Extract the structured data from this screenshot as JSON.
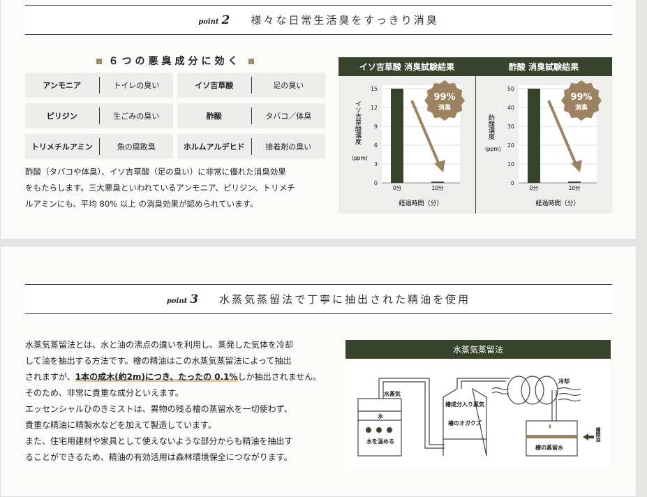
{
  "point2": {
    "label": "point",
    "num": "2",
    "title": "様々な日常生活臭をすっきり消臭"
  },
  "odor": {
    "heading": "６つの悪臭成分に効く",
    "items": [
      {
        "name": "アンモニア",
        "smell": "トイレの臭い"
      },
      {
        "name": "イソ吉草酸",
        "smell": "足の臭い"
      },
      {
        "name": "ピリジン",
        "smell": "生ごみの臭い"
      },
      {
        "name": "酢酸",
        "smell": "タバコ／体臭"
      },
      {
        "name": "トリメチルアミン",
        "smell": "魚の腐敗臭"
      },
      {
        "name": "ホルムアルデヒド",
        "smell": "接着剤の臭い"
      }
    ],
    "paragraph": [
      "酢酸（タバコや体臭）、イソ吉草酸（足の臭い）に非常に優れた消臭効果",
      "をもたらします。三大悪臭といわれているアンモニア、ピリジン、トリメチ",
      "ルアミンにも、平均 80% 以上 の消臭効果が認められています。"
    ]
  },
  "chart_data": [
    {
      "type": "bar",
      "title": "イソ吉草酸 消臭試験結果",
      "categories": [
        "0分",
        "10分"
      ],
      "values": [
        15,
        0.2
      ],
      "ylabel": "イソ吉草酸濃度(ppm)",
      "xlabel": "経過時間（分）",
      "ylim": [
        0,
        15
      ],
      "yticks": [
        "0",
        "3",
        "6",
        "9",
        "12",
        "15"
      ],
      "badge": {
        "pct": "99%",
        "text": "消臭"
      }
    },
    {
      "type": "bar",
      "title": "酢酸 消臭試験結果",
      "categories": [
        "0分",
        "10分"
      ],
      "values": [
        50,
        0.7
      ],
      "ylabel": "酢酸濃度(ppm)",
      "xlabel": "経過時間（分）",
      "ylim": [
        0,
        50
      ],
      "yticks": [
        "0",
        "10",
        "20",
        "30",
        "40",
        "50"
      ],
      "badge": {
        "pct": "99%",
        "text": "消臭"
      }
    }
  ],
  "point3": {
    "label": "point",
    "num": "3",
    "title": "水蒸気蒸留法で丁寧に抽出された精油を使用"
  },
  "steam": {
    "p1a": "水蒸気蒸留法とは、水と油の沸点の違いを利用し、蒸発した気体を冷却",
    "p1b": "して油を抽出する方法です。檜の精油はこの水蒸気蒸留法によって抽出",
    "p1c": "されますが、",
    "p1hl": "1本の成木(約2m)につき、たったの 0.1%",
    "p1d": "しか抽出されません。",
    "p1e": "そのため、非常に貴重な成分といえます。",
    "p2a": "エッセンシャルひのきミストは、異物の残る檜の蒸留水を一切使わず、",
    "p2b": "貴重な精油に精製水などを加えて製造しています。",
    "p3a": "また、住宅用建材や家具として使えないような部分からも精油を抽出す",
    "p3b": "ることができるため、精油の有効活用は森林環境保全につながります。"
  },
  "diagram": {
    "title": "水蒸気蒸留法",
    "steam": "水蒸気",
    "water": "水",
    "heat": "水を温める",
    "vapor": "檜成分入り蒸気",
    "chips": "檜のオガクズ",
    "cool": "冷却",
    "distilled": "檜の蒸留水",
    "oil": "檜精油"
  },
  "colors": {
    "green": "#38432c",
    "gold": "#9c8260"
  }
}
